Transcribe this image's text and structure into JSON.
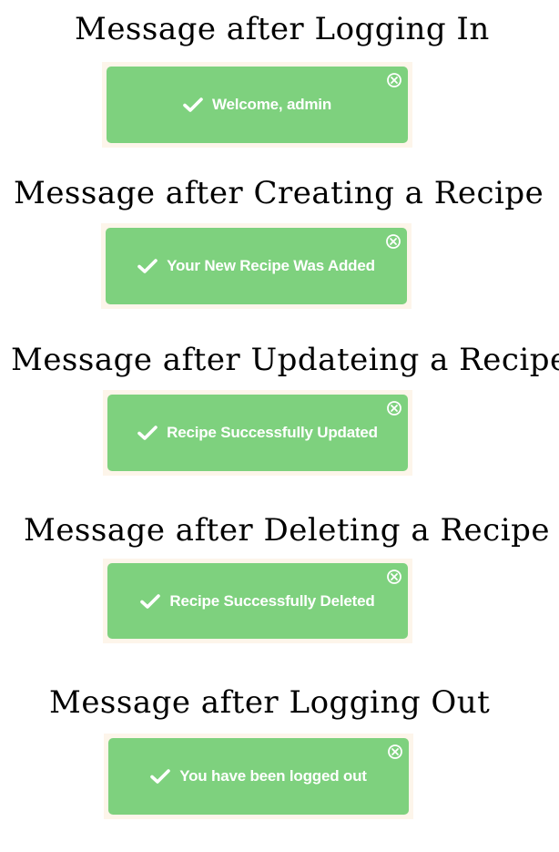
{
  "sections": [
    {
      "heading": "Message after Logging In",
      "message": "Welcome, admin"
    },
    {
      "heading": "Message after Creating a Recipe",
      "message": "Your New Recipe Was Added"
    },
    {
      "heading": "Message after Updateing a Recipe",
      "message": "Recipe Successfully Updated"
    },
    {
      "heading": "Message after Deleting a Recipe",
      "message": "Recipe Successfully Deleted"
    },
    {
      "heading": "Message after Logging Out",
      "message": "You have been logged out"
    }
  ],
  "colors": {
    "toast_background": "#7ed17e",
    "toast_frame": "#fdf5ea",
    "toast_text": "#ffffff",
    "heading_text": "#000000"
  },
  "icons": {
    "status": "check-icon",
    "dismiss": "close-circle-icon"
  }
}
